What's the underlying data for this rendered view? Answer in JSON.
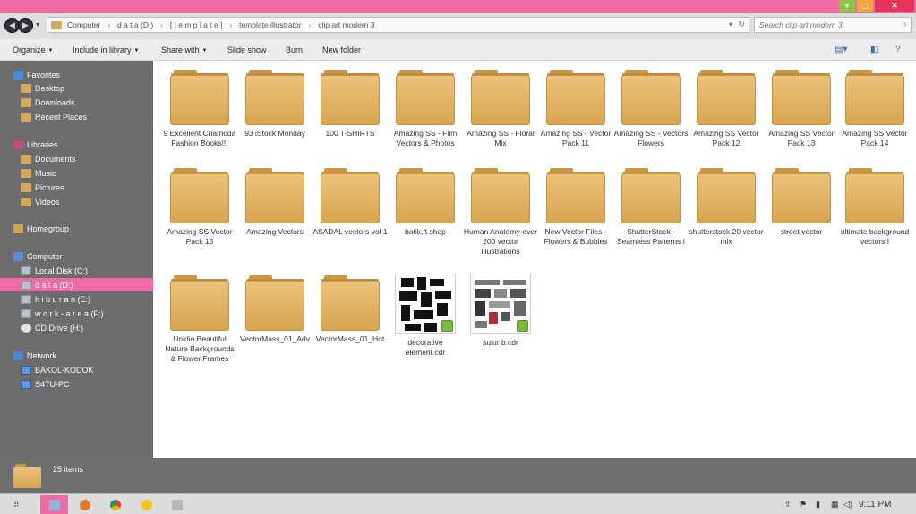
{
  "window": {
    "minimize_glyph": "▾",
    "maximize_glyph": "□",
    "close_glyph": "✕"
  },
  "nav": {
    "back_glyph": "◀",
    "forward_glyph": "▶",
    "dropdown_glyph": "▾",
    "breadcrumbs": [
      "Computer",
      "d a t a (D:)",
      "[ t e m p l a t e ]",
      "template illustrator",
      "clip art modern 3"
    ],
    "breadcrumb_separator": "›",
    "search_placeholder": "Search clip art modern 3",
    "search_icon": "search-icon"
  },
  "toolbar": {
    "organize": "Organize",
    "include_in_library": "Include in library",
    "share_with": "Share with",
    "slide_show": "Slide show",
    "burn": "Burn",
    "new_folder": "New folder",
    "dropdown_arrow": "▼"
  },
  "sidebar": {
    "favorites": {
      "label": "Favorites",
      "items": [
        "Desktop",
        "Downloads",
        "Recent Places"
      ]
    },
    "libraries": {
      "label": "Libraries",
      "items": [
        "Documents",
        "Music",
        "Pictures",
        "Videos"
      ]
    },
    "homegroup": {
      "label": "Homegroup"
    },
    "computer": {
      "label": "Computer",
      "items": [
        "Local Disk (C:)",
        "d a t a (D:)",
        "h i b u r a n (E:)",
        "w o r k - a r e a (F:)",
        "CD Drive (H:)"
      ],
      "selected": "d a t a (D:)"
    },
    "network": {
      "label": "Network",
      "items": [
        "BAKOL-KODOK",
        "S4TU-PC"
      ]
    }
  },
  "files": [
    {
      "name": "9 Excellent Criamoda Fashion Books!!!",
      "type": "folder"
    },
    {
      "name": "93 iStock Monday",
      "type": "folder"
    },
    {
      "name": "100 T-SHIRTS",
      "type": "folder"
    },
    {
      "name": "Amazing SS - Film Vectors & Photos",
      "type": "folder"
    },
    {
      "name": "Amazing SS - Floral Mix",
      "type": "folder"
    },
    {
      "name": "Amazing SS - Vector Pack 11",
      "type": "folder"
    },
    {
      "name": "Amazing SS - Vectors Flowers",
      "type": "folder"
    },
    {
      "name": "Amazing SS Vector Pack 12",
      "type": "folder"
    },
    {
      "name": "Amazing SS Vector Pack 13",
      "type": "folder"
    },
    {
      "name": "Amazing SS Vector Pack 14",
      "type": "folder"
    },
    {
      "name": "Amazing SS Vector Pack 15",
      "type": "folder"
    },
    {
      "name": "Amazing Vectors",
      "type": "folder"
    },
    {
      "name": "ASADAL vectors vol 1",
      "type": "folder"
    },
    {
      "name": "batik,ft shop",
      "type": "folder"
    },
    {
      "name": "Human Anatomy-over 200 vector Illustrations",
      "type": "folder"
    },
    {
      "name": "New Vector Files - Flowers & Bubbles",
      "type": "folder"
    },
    {
      "name": "ShutterStock - Seamless Patterns I",
      "type": "folder"
    },
    {
      "name": "shutterstock 20 vector mix",
      "type": "folder"
    },
    {
      "name": "street vector",
      "type": "folder"
    },
    {
      "name": "ultimate background vectors I",
      "type": "folder"
    },
    {
      "name": "Unidio Beautiful Nature Backgrounds & Flower Frames",
      "type": "folder"
    },
    {
      "name": "VectorMass_01_Adv",
      "type": "folder"
    },
    {
      "name": "VectorMass_01_Hot",
      "type": "folder"
    },
    {
      "name": "decorative element.cdr",
      "type": "cdr"
    },
    {
      "name": "sulur b.cdr",
      "type": "cdr"
    }
  ],
  "details": {
    "count": "25 items"
  },
  "taskbar": {
    "start_glyph": "⠿",
    "apps": [
      "explorer-icon",
      "firefox-icon",
      "chrome-icon",
      "emoticon-icon",
      "tool-icon"
    ],
    "clock": "9:11 PM"
  },
  "colors": {
    "accent": "#f06aa6",
    "folder": "#dcae5e",
    "sidebar": "#6c6c6c"
  }
}
